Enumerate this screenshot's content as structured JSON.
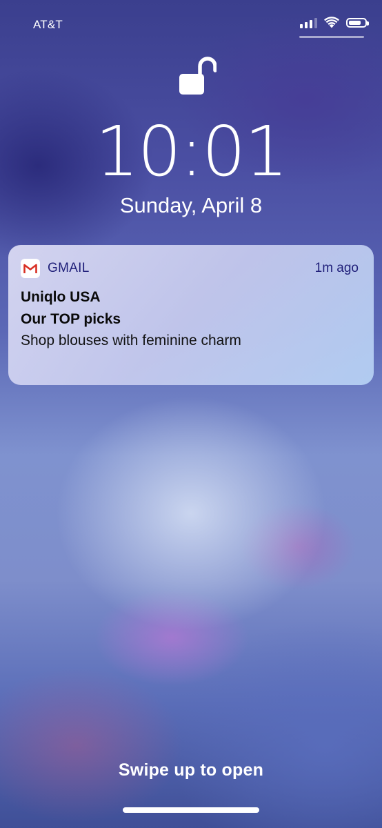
{
  "status_bar": {
    "carrier": "AT&T",
    "signal_bars": 4,
    "signal_bars_active": 3,
    "wifi_icon": "wifi-icon",
    "battery_icon": "battery-icon",
    "battery_level": 0.75
  },
  "lock_screen": {
    "lock_icon": "unlocked-padlock-icon",
    "time": "10:01",
    "date": "Sunday, April 8"
  },
  "notification": {
    "app_icon": "gmail-icon",
    "app_name": "GMAIL",
    "time": "1m ago",
    "title": "Uniqlo USA",
    "subtitle": "Our TOP picks",
    "body": "Shop blouses with feminine charm"
  },
  "footer": {
    "swipe_hint": "Swipe up to open"
  },
  "colors": {
    "notification_accent": "#20207a",
    "gmail_red": "#d93025"
  }
}
